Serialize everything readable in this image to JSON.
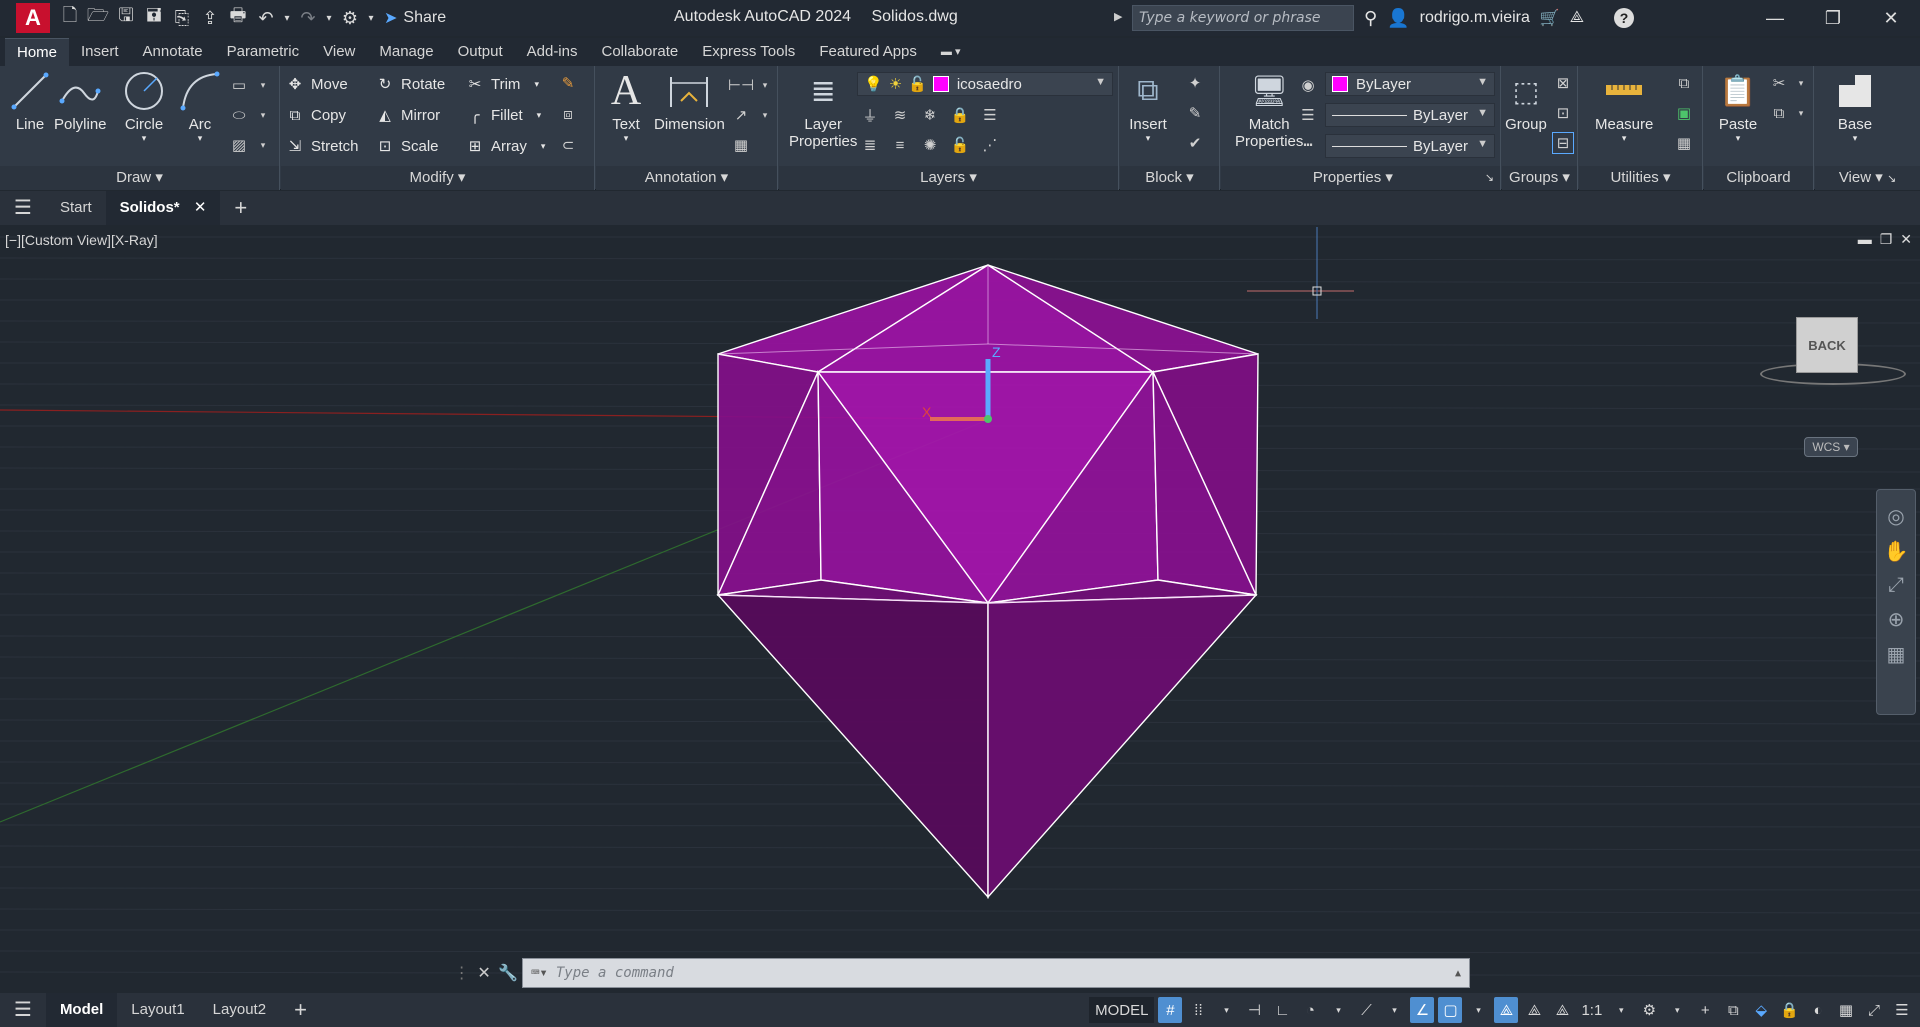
{
  "window": {
    "app_title": "Autodesk AutoCAD 2024",
    "file_title": "Solidos.dwg",
    "logo_letter": "A",
    "share_label": "Share",
    "search_placeholder": "Type a keyword or phrase",
    "username": "rodrigo.m.vieira"
  },
  "ribbon_tabs": [
    "Home",
    "Insert",
    "Annotate",
    "Parametric",
    "View",
    "Manage",
    "Output",
    "Add-ins",
    "Collaborate",
    "Express Tools",
    "Featured Apps"
  ],
  "ribbon": {
    "draw": {
      "title": "Draw",
      "line": "Line",
      "polyline": "Polyline",
      "circle": "Circle",
      "arc": "Arc"
    },
    "modify": {
      "title": "Modify",
      "move": "Move",
      "rotate": "Rotate",
      "trim": "Trim",
      "copy": "Copy",
      "mirror": "Mirror",
      "fillet": "Fillet",
      "stretch": "Stretch",
      "scale": "Scale",
      "array": "Array"
    },
    "annotation": {
      "title": "Annotation",
      "text": "Text",
      "dimension": "Dimension"
    },
    "layers": {
      "title": "Layers",
      "layer_properties_1": "Layer",
      "layer_properties_2": "Properties",
      "current_layer": "icosaedro"
    },
    "block": {
      "title": "Block",
      "insert": "Insert"
    },
    "properties": {
      "title": "Properties",
      "match_1": "Match",
      "match_2": "Properties",
      "color": "ByLayer",
      "linetype": "ByLayer",
      "lineweight": "ByLayer"
    },
    "groups": {
      "title": "Groups",
      "group": "Group"
    },
    "utilities": {
      "title": "Utilities",
      "measure": "Measure"
    },
    "clipboard": {
      "title": "Clipboard",
      "paste": "Paste"
    },
    "view": {
      "title": "View",
      "base": "Base"
    }
  },
  "doc_tabs": {
    "start": "Start",
    "active": "Solidos*"
  },
  "viewport": {
    "label": "[−][Custom View][X-Ray]",
    "viewcube_face": "BACK",
    "wcs": "WCS",
    "ucs_z": "Z",
    "ucs_x": "X",
    "solid_color": "#a012a8"
  },
  "command": {
    "placeholder": "Type a command"
  },
  "status": {
    "model_tab": "Model",
    "layout1": "Layout1",
    "layout2": "Layout2",
    "space": "MODEL",
    "scale": "1:1"
  }
}
